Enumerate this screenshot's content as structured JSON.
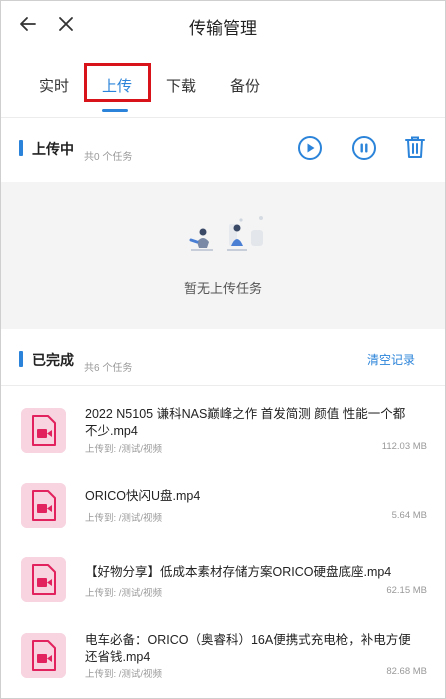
{
  "header": {
    "title": "传输管理"
  },
  "tabs": [
    {
      "label": "实时"
    },
    {
      "label": "上传"
    },
    {
      "label": "下载"
    },
    {
      "label": "备份"
    }
  ],
  "uploading": {
    "title": "上传中",
    "count_text": "共0 个任务",
    "empty_text": "暂无上传任务"
  },
  "completed": {
    "title": "已完成",
    "count_text": "共6 个任务",
    "clear_label": "清空记录",
    "items": [
      {
        "name": "2022 N5105 谦科NAS巅峰之作 首发简测 颜值 性能一个都不少.mp4",
        "path": "上传到: /测试/视频",
        "size": "112.03 MB"
      },
      {
        "name": "ORICO快闪U盘.mp4",
        "path": "上传到: /测试/视频",
        "size": "5.64 MB"
      },
      {
        "name": "【好物分享】低成本素材存储方案ORICO硬盘底座.mp4",
        "path": "上传到: /测试/视频",
        "size": "62.15 MB"
      },
      {
        "name": "电车必备：ORICO（奥睿科）16A便携式充电枪，补电方便还省钱.mp4",
        "path": "上传到: /测试/视频",
        "size": "82.68 MB"
      }
    ]
  },
  "colors": {
    "accent": "#2b84d9",
    "highlight": "#d8131a",
    "file_icon_bg": "#f7d4df",
    "file_icon_fg": "#e2215f"
  },
  "icons": {
    "back": "arrow-left-icon",
    "close": "close-icon",
    "play": "play-circle-icon",
    "pause": "pause-circle-icon",
    "delete": "trash-icon",
    "file": "video-file-icon"
  }
}
